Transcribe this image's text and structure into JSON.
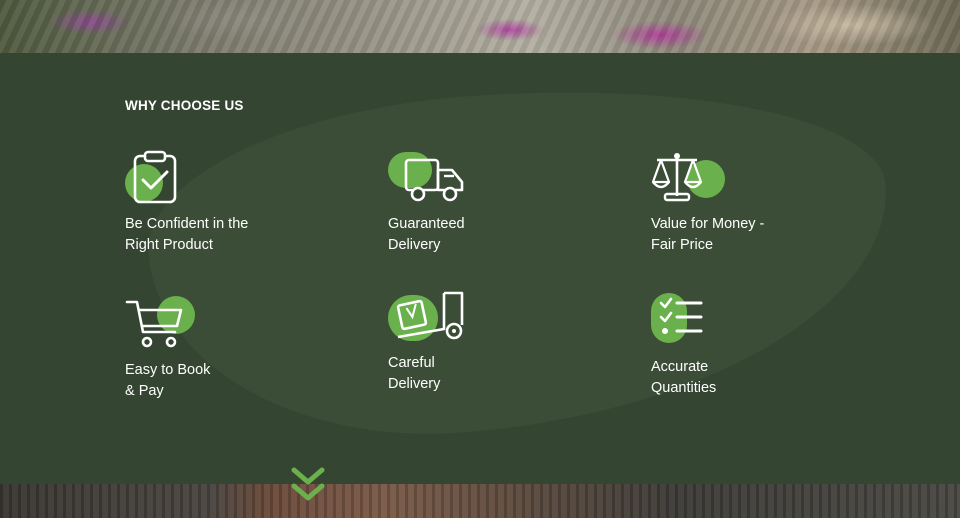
{
  "section": {
    "heading": "WHY CHOOSE US",
    "features": [
      {
        "label": "Be Confident in the\nRight Product",
        "icon": "clipboard-check-icon"
      },
      {
        "label": "Guaranteed\nDelivery",
        "icon": "delivery-truck-icon"
      },
      {
        "label": "Value for Money -\nFair Price",
        "icon": "balance-scale-icon"
      },
      {
        "label": "Easy to Book\n& Pay",
        "icon": "shopping-cart-icon"
      },
      {
        "label": "Careful\nDelivery",
        "icon": "hand-truck-box-icon"
      },
      {
        "label": "Accurate\nQuantities",
        "icon": "checklist-icon"
      }
    ]
  },
  "scroll_down": {
    "icon": "double-chevron-down-icon"
  },
  "colors": {
    "section_bg": "#344531",
    "blob": "#3b4d37",
    "accent": "#6ab04c",
    "text": "#ffffff"
  }
}
